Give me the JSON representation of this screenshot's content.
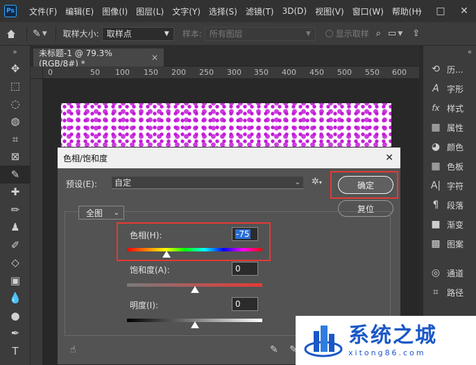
{
  "app": {
    "logo_text": "Ps",
    "menus": [
      "文件(F)",
      "编辑(E)",
      "图像(I)",
      "图层(L)",
      "文字(Y)",
      "选择(S)",
      "滤镜(T)",
      "3D(D)",
      "视图(V)",
      "窗口(W)",
      "帮助(H)"
    ],
    "window_controls": {
      "minimize": "—",
      "maximize": "□",
      "close": "✕"
    }
  },
  "options_bar": {
    "sample_size_label": "取样大小:",
    "sample_size_value": "取样点",
    "sample_label": "样本:",
    "sample_value": "所有图层",
    "show_ring_label": "显示取样"
  },
  "document": {
    "tab_title": "未标题-1 @ 79.3%(RGB/8#) *",
    "tab_close": "×",
    "ruler_ticks": [
      "0",
      "50",
      "100",
      "150",
      "200",
      "250",
      "300",
      "350",
      "400",
      "450",
      "500",
      "550",
      "600"
    ],
    "halftone_color": "#c21bd8"
  },
  "panels": {
    "items": [
      {
        "icon": "history-icon",
        "glyph": "⟲",
        "label": "历..."
      },
      {
        "icon": "glyph-icon",
        "glyph": "A",
        "label": "字形"
      },
      {
        "icon": "styles-icon",
        "glyph": "fx",
        "label": "样式"
      },
      {
        "icon": "properties-icon",
        "glyph": "▦",
        "label": "属性"
      },
      {
        "icon": "color-icon",
        "glyph": "◕",
        "label": "颜色"
      },
      {
        "icon": "swatches-icon",
        "glyph": "▦",
        "label": "色板"
      },
      {
        "icon": "character-icon",
        "glyph": "A|",
        "label": "字符"
      },
      {
        "icon": "paragraph-icon",
        "glyph": "¶",
        "label": "段落"
      },
      {
        "icon": "gradient-icon",
        "glyph": "■",
        "label": "渐变"
      },
      {
        "icon": "patterns-icon",
        "glyph": "▩",
        "label": "图案"
      },
      {
        "icon": "channels-icon",
        "glyph": "◎",
        "label": "通道"
      },
      {
        "icon": "paths-icon",
        "glyph": "⌗",
        "label": "路径"
      }
    ]
  },
  "dialog": {
    "title": "色相/饱和度",
    "close": "✕",
    "preset_label": "预设(E):",
    "preset_value": "自定",
    "ok_label": "确定",
    "reset_label": "复位",
    "channel_value": "全图",
    "hue_label": "色相(H):",
    "hue_value": "-75",
    "hue_range": [
      -180,
      180
    ],
    "saturation_label": "饱和度(A):",
    "saturation_value": "0",
    "saturation_range": [
      -100,
      100
    ],
    "lightness_label": "明度(I):",
    "lightness_value": "0",
    "lightness_range": [
      -100,
      100
    ],
    "highlight_color": "#e53935"
  },
  "watermark": {
    "title": "系统之城",
    "subtitle": "xitong86.com",
    "brand_color": "#1b58c7"
  }
}
